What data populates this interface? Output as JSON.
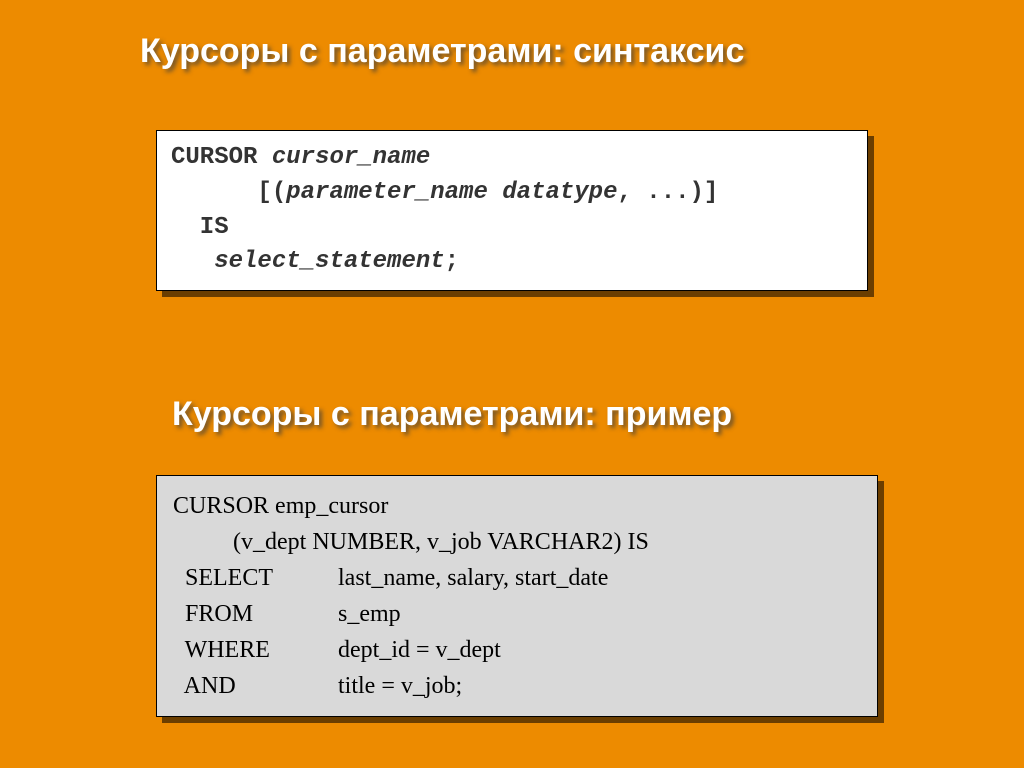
{
  "heading1": "Курсоры с параметрами: синтаксис",
  "heading2": "Курсоры с параметрами: пример",
  "syntax": {
    "l1a": "CURSOR ",
    "l1b": "cursor_name",
    "l2a": "      [(",
    "l2b": "parameter_name",
    "l2c": " ",
    "l2d": "datatype",
    "l2e": ", ...)]",
    "l3": "  IS",
    "l4a": "   ",
    "l4b": "select_statement",
    "l4c": ";"
  },
  "example": {
    "l1": "CURSOR emp_cursor",
    "l2": "          (v_dept NUMBER, v_job VARCHAR2) IS",
    "l3k": "  SELECT",
    "l3v": "last_name, salary, start_date",
    "l4k": "  FROM",
    "l4v": "s_emp",
    "l5k": "  WHERE",
    "l5v": "dept_id = v_dept",
    "l6k": "  AND",
    "l6v": "title = v_job;"
  }
}
